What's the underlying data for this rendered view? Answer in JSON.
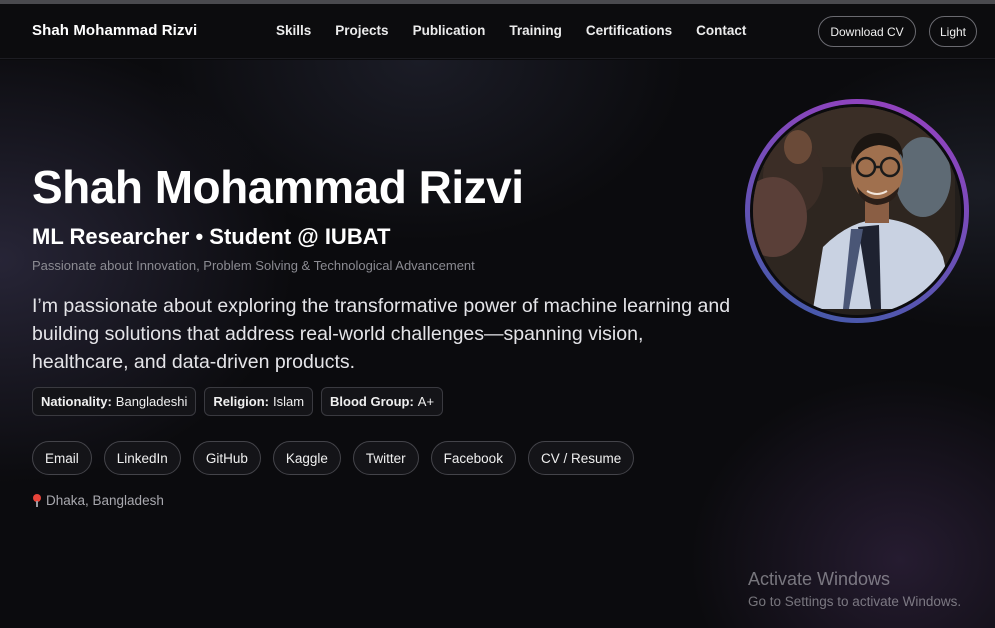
{
  "nav": {
    "brand": "Shah Mohammad Rizvi",
    "links": [
      "Skills",
      "Projects",
      "Publication",
      "Training",
      "Certifications",
      "Contact"
    ],
    "download_cv": "Download CV",
    "theme_toggle": "Light"
  },
  "hero": {
    "name": "Shah Mohammad Rizvi",
    "role": "ML Researcher • Student @ IUBAT",
    "tagline": "Passionate about Innovation, Problem Solving & Technological Advancement",
    "bio": "I’m passionate about exploring the transformative power of machine learning and building solutions that address real-world challenges—spanning vision, healthcare, and data-driven products.",
    "facts": [
      {
        "label": "Nationality:",
        "value": "Bangladeshi"
      },
      {
        "label": "Religion:",
        "value": "Islam"
      },
      {
        "label": "Blood Group:",
        "value": "A+"
      }
    ],
    "links": [
      "Email",
      "LinkedIn",
      "GitHub",
      "Kaggle",
      "Twitter",
      "Facebook",
      "CV / Resume"
    ],
    "location": "Dhaka, Bangladesh",
    "location_icon": "pin-icon"
  },
  "overlay": {
    "title": "Activate Windows",
    "subtitle": "Go to Settings to activate Windows."
  },
  "colors": {
    "background": "#0b0b0e",
    "ring_start": "#9a3fc0",
    "ring_end": "#3e5ca8"
  }
}
